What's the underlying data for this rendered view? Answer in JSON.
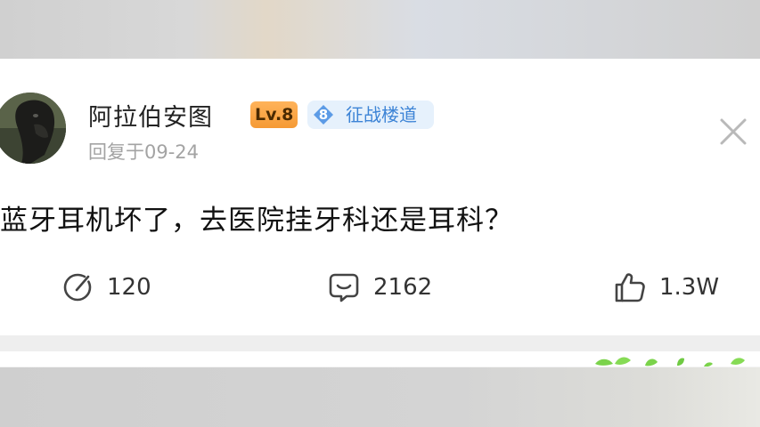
{
  "post": {
    "username": "阿拉伯安图",
    "level_badge": "Lv.8",
    "guild_badge": {
      "number": "8",
      "name": "征战楼道"
    },
    "reply_time": "回复于09-24",
    "content": "蓝牙耳机坏了，去医院挂牙科还是耳科？"
  },
  "actions": {
    "share_count": "120",
    "comment_count": "2162",
    "like_count": "1.3W"
  },
  "icons": [
    "avatar",
    "diamond-badge-icon",
    "close-icon",
    "share-icon",
    "comment-icon",
    "like-icon",
    "leaf-decoration-icon"
  ],
  "colors": {
    "level_badge": "#F59A35",
    "guild_badge_bg": "#E6F1FC",
    "guild_badge_text": "#3D84D6",
    "meta_text": "#A3A3A3",
    "decoration_green": "#7BD34B"
  }
}
